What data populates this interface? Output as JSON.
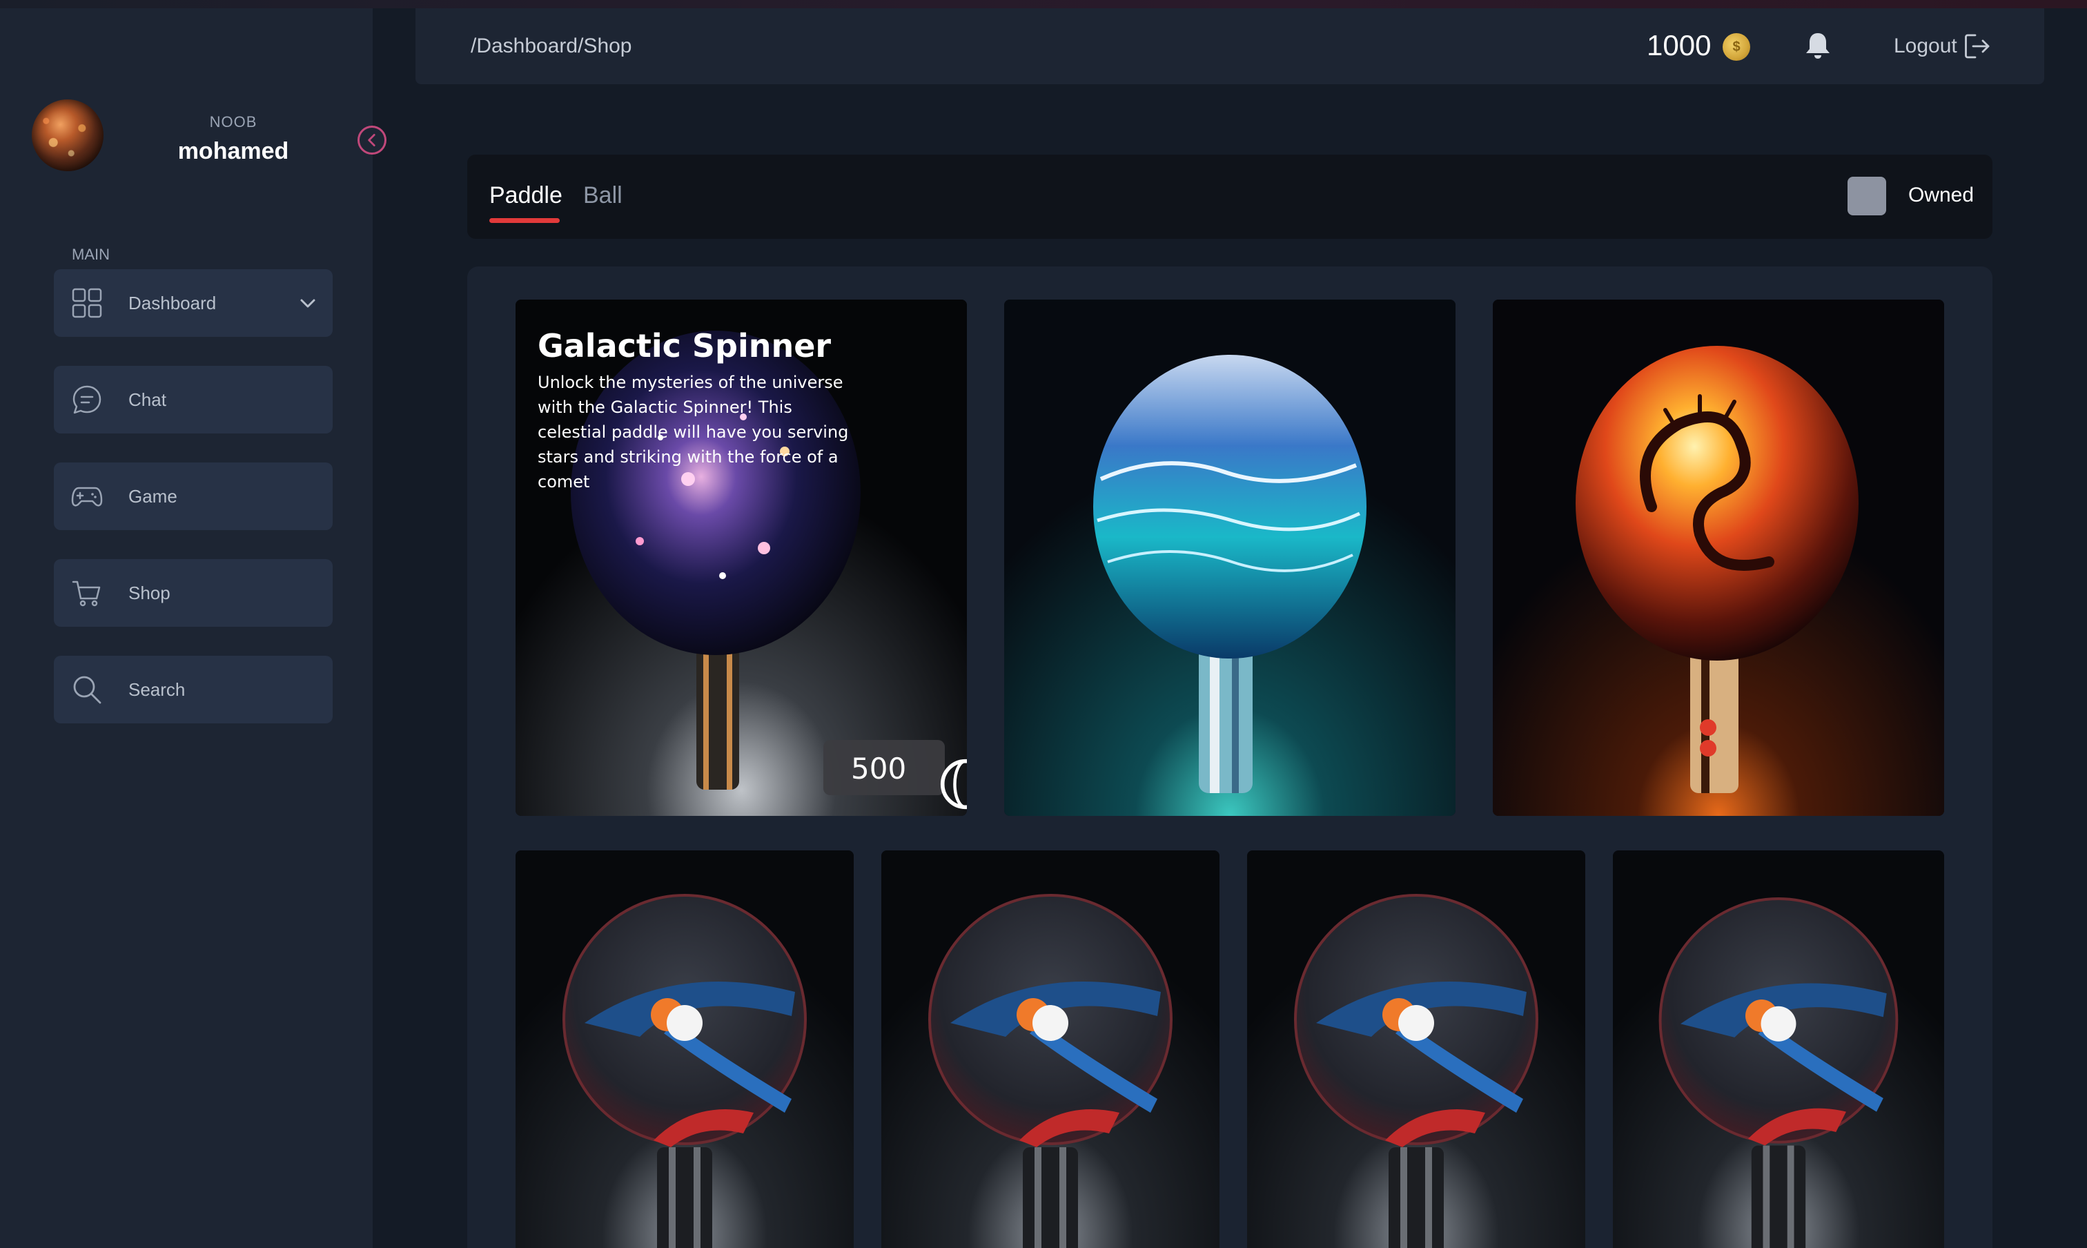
{
  "user": {
    "rank": "NOOB",
    "name": "mohamed"
  },
  "sidebar": {
    "section": "MAIN",
    "items": [
      {
        "label": "Dashboard",
        "icon": "grid-icon"
      },
      {
        "label": "Chat",
        "icon": "chat-icon"
      },
      {
        "label": "Game",
        "icon": "gamepad-icon"
      },
      {
        "label": "Shop",
        "icon": "cart-icon"
      },
      {
        "label": "Search",
        "icon": "search-icon"
      }
    ]
  },
  "header": {
    "breadcrumb": "/Dashboard/Shop",
    "coins": "1000",
    "logout": "Logout"
  },
  "tabs": {
    "paddle": "Paddle",
    "ball": "Ball",
    "owned": "Owned",
    "accent": "#e23a3a"
  },
  "shop": {
    "featured": {
      "title": "Galactic Spinner",
      "description": "Unlock the mysteries of the universe with the Galactic Spinner! This celestial paddle will have you serving stars and striking with the force of a comet",
      "price": "500"
    },
    "items": [
      {
        "name": "galaxy-paddle"
      },
      {
        "name": "ocean-wave-paddle"
      },
      {
        "name": "fire-dragon-paddle"
      },
      {
        "name": "classic-paddle"
      },
      {
        "name": "classic-paddle"
      },
      {
        "name": "classic-paddle"
      },
      {
        "name": "classic-paddle"
      }
    ]
  }
}
